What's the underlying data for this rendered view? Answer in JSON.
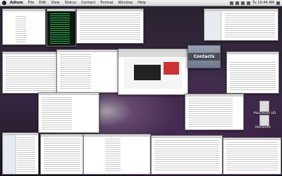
{
  "menubar": {
    "app_name": "Adium",
    "items": [
      "File",
      "Edit",
      "View",
      "Status",
      "Contact",
      "Format",
      "Window",
      "Help"
    ],
    "clock": "Tu 10:44 AM"
  },
  "contacts_window": {
    "label": "Contacts"
  },
  "desktop_icons": [
    {
      "label": "Macintosh HD"
    },
    {
      "label": "MacStuffs"
    }
  ]
}
